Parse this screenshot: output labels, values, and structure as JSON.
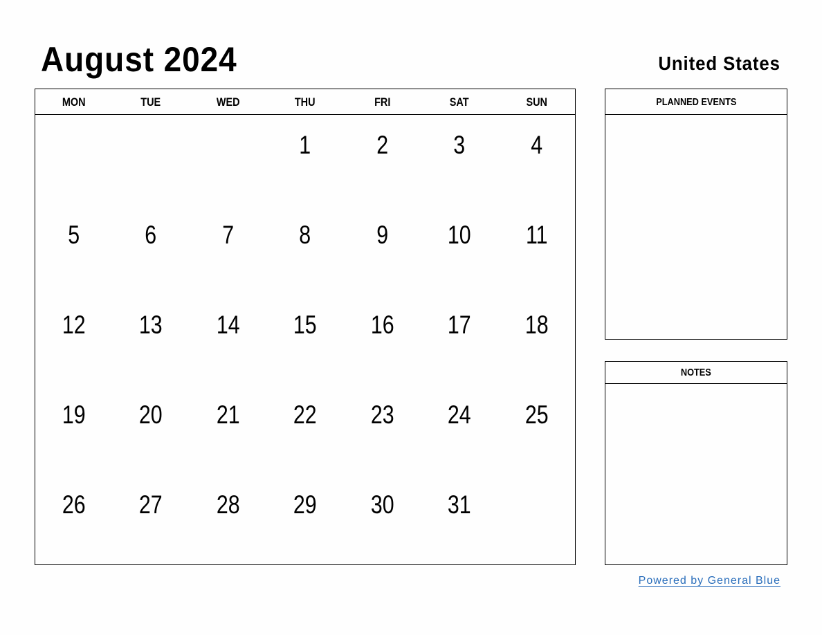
{
  "header": {
    "title": "August 2024",
    "country": "United States"
  },
  "calendar": {
    "weekdays": [
      "MON",
      "TUE",
      "WED",
      "THU",
      "FRI",
      "SAT",
      "SUN"
    ],
    "weeks": [
      [
        "",
        "",
        "",
        "1",
        "2",
        "3",
        "4"
      ],
      [
        "5",
        "6",
        "7",
        "8",
        "9",
        "10",
        "11"
      ],
      [
        "12",
        "13",
        "14",
        "15",
        "16",
        "17",
        "18"
      ],
      [
        "19",
        "20",
        "21",
        "22",
        "23",
        "24",
        "25"
      ],
      [
        "26",
        "27",
        "28",
        "29",
        "30",
        "31",
        ""
      ]
    ]
  },
  "panels": {
    "planned_events": {
      "title": "PLANNED EVENTS"
    },
    "notes": {
      "title": "NOTES"
    }
  },
  "footer": {
    "powered_by": "Powered by General Blue",
    "link_color": "#2a6ebb"
  }
}
